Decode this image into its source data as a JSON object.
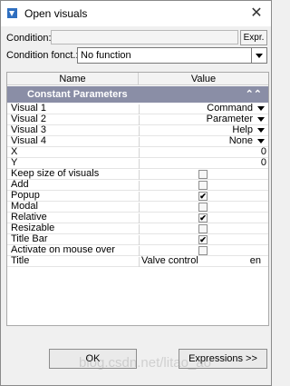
{
  "window": {
    "title": "Open visuals",
    "close_glyph": "✕"
  },
  "condition": {
    "label": "Condition:",
    "value": "",
    "expr_label": "Expr."
  },
  "condition_function": {
    "label": "Condition fonct.:",
    "value": "No function"
  },
  "grid": {
    "headers": {
      "name": "Name",
      "value": "Value"
    },
    "section": {
      "label": "Constant Parameters",
      "toggle_glyph": "≈"
    },
    "rows": [
      {
        "name": "Visual 1",
        "value": "Command",
        "kind": "dropdown"
      },
      {
        "name": "Visual 2",
        "value": "Parameter",
        "kind": "dropdown"
      },
      {
        "name": "Visual 3",
        "value": "Help",
        "kind": "dropdown"
      },
      {
        "name": "Visual 4",
        "value": "None",
        "kind": "dropdown"
      },
      {
        "name": "X",
        "value": "0",
        "kind": "number"
      },
      {
        "name": "Y",
        "value": "0",
        "kind": "number"
      },
      {
        "name": "Keep size of visuals",
        "checked": false,
        "kind": "checkbox"
      },
      {
        "name": "Add",
        "checked": false,
        "kind": "checkbox"
      },
      {
        "name": "Popup",
        "checked": true,
        "kind": "checkbox"
      },
      {
        "name": "Modal",
        "checked": false,
        "kind": "checkbox"
      },
      {
        "name": "Relative",
        "checked": true,
        "kind": "checkbox"
      },
      {
        "name": "Resizable",
        "checked": false,
        "kind": "checkbox"
      },
      {
        "name": "Title Bar",
        "checked": true,
        "kind": "checkbox"
      },
      {
        "name": "Activate on mouse over",
        "checked": false,
        "kind": "checkbox"
      },
      {
        "name": "Title",
        "value": "Valve control",
        "lang": "en",
        "kind": "text"
      }
    ]
  },
  "buttons": {
    "ok": "OK",
    "expressions": "Expressions >>"
  },
  "watermark": "blog.csdn.net/litao_ao",
  "colors": {
    "section_bg": "#8a8ea6",
    "window_bg": "#f0f0f0"
  }
}
